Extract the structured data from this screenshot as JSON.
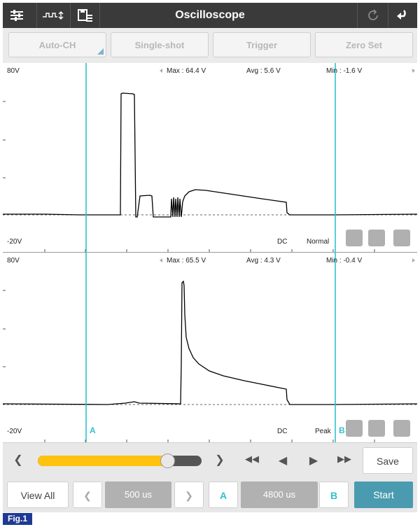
{
  "app": {
    "title": "Oscilloscope"
  },
  "toolbar_icons": [
    "sliders-icon",
    "waveform-icon",
    "save-list-icon",
    "refresh-icon",
    "back-icon"
  ],
  "modes": {
    "auto_ch": "Auto-CH",
    "single_shot": "Single-shot",
    "trigger": "Trigger",
    "zero_set": "Zero Set"
  },
  "channels": [
    {
      "vmax": "80V",
      "vmin": "-20V",
      "max": "Max : 64.4 V",
      "avg": "Avg : 5.6 V",
      "min": "Min : -1.6 V",
      "coupling": "DC",
      "mode": "Normal"
    },
    {
      "vmax": "80V",
      "vmin": "-20V",
      "max": "Max : 65.5 V",
      "avg": "Avg : 4.3 V",
      "min": "Min : -0.4 V",
      "coupling": "DC",
      "mode": "Peak"
    }
  ],
  "cursors": {
    "a": "A",
    "b": "B",
    "color": "#2fc1cf"
  },
  "position_slider": {
    "value_fraction": 0.79,
    "color": "#ffc20e"
  },
  "controls": {
    "save": "Save",
    "view_all": "View All",
    "time_div": "500 us",
    "cursor_a": "A",
    "cursor_delta": "4800 us",
    "cursor_b": "B",
    "start": "Start"
  },
  "colors": {
    "start_bg": "#4a9bb0",
    "titlebar_bg": "#3a3a3a"
  },
  "figure_label": "Fig.1"
}
